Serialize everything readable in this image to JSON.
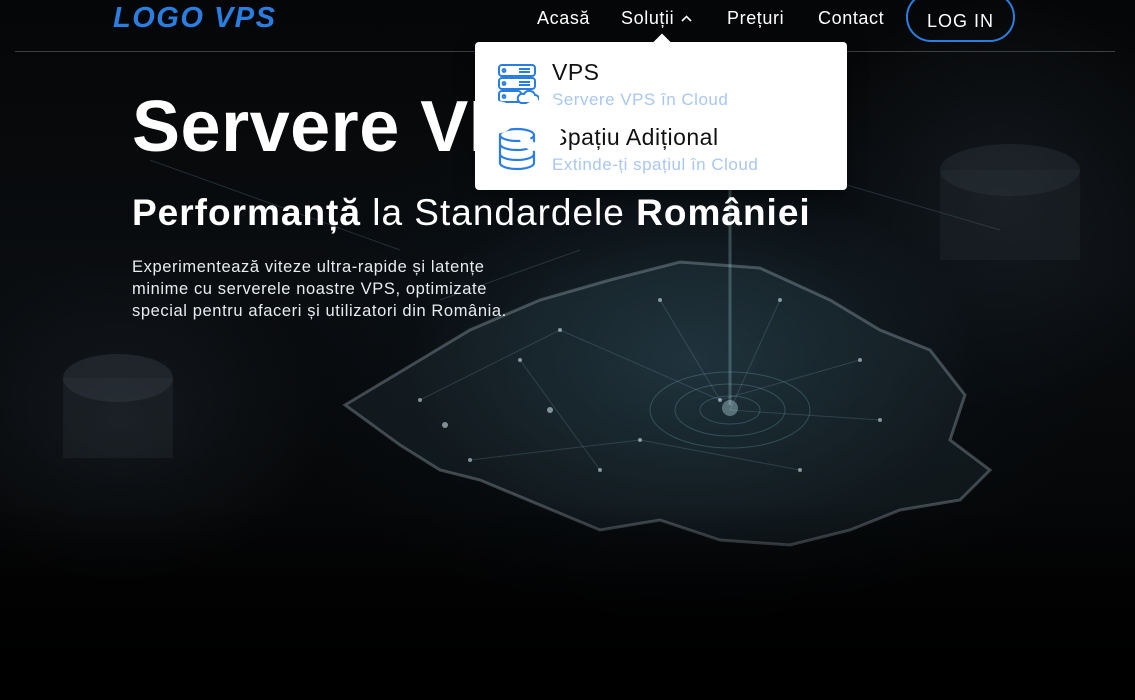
{
  "header": {
    "logo": "LOGO VPS",
    "nav": {
      "home": "Acasă",
      "solutions": "Soluții",
      "prices": "Prețuri",
      "contact": "Contact"
    },
    "login_label": "LOG IN"
  },
  "dropdown": {
    "items": [
      {
        "title": "VPS",
        "subtitle": "Servere VPS în Cloud",
        "icon": "server-cloud-icon"
      },
      {
        "title": "Spațiu Adițional",
        "subtitle": "Extinde-ți spațiul în Cloud",
        "icon": "database-icon"
      }
    ]
  },
  "hero": {
    "title": "Servere VPS",
    "subtitle_bold_1": "Performanță",
    "subtitle_mid": " la Standardele ",
    "subtitle_bold_2": "României",
    "description": "Experimentează viteze ultra-rapide și latențe minime cu serverele noastre VPS, optimizate special pentru afaceri și utilizatori din România."
  },
  "colors": {
    "accent": "#2a7de1",
    "dropdown_subtitle": "#a9c7ef",
    "background": "#000000"
  }
}
